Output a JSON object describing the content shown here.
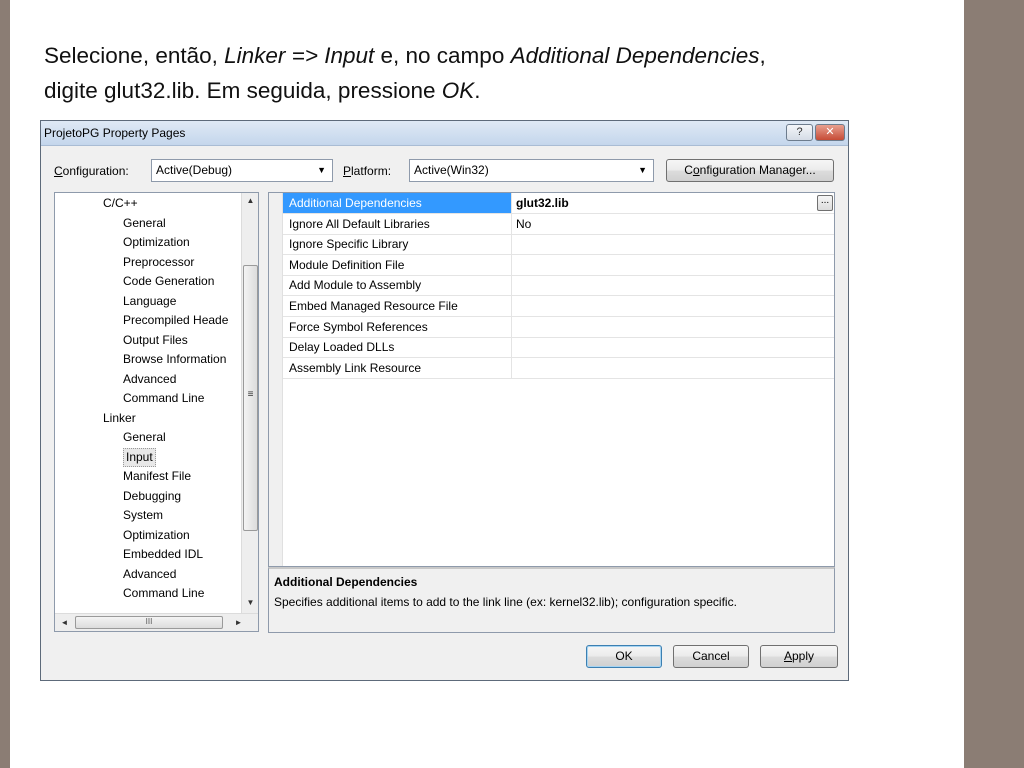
{
  "slide": {
    "line1_a": "Selecione, então, ",
    "line1_b": "Linker => Input",
    "line1_c": " e, no campo ",
    "line1_d": "Additional Dependencies",
    "line1_e": ",",
    "line2_a": "digite glut32.lib. Em seguida, pressione ",
    "line2_b": "OK",
    "line2_c": "."
  },
  "dialog": {
    "title": "ProjetoPG Property Pages",
    "help_label": "?",
    "close_label": "✕",
    "configuration_label_first": "C",
    "configuration_label_rest": "onfiguration:",
    "configuration_value": "Active(Debug)",
    "platform_label_first": "P",
    "platform_label_rest": "latform:",
    "platform_value": "Active(Win32)",
    "config_manager_a": "C",
    "config_manager_b": "o",
    "config_manager_c": "nfiguration Manager...",
    "dropdown_arrow": "▼",
    "ok_label": "OK",
    "cancel_label": "Cancel",
    "apply_label_first": "A",
    "apply_label_rest": "pply"
  },
  "tree": {
    "items": [
      {
        "label": "C/C++",
        "level": 1
      },
      {
        "label": "General",
        "level": 2
      },
      {
        "label": "Optimization",
        "level": 2
      },
      {
        "label": "Preprocessor",
        "level": 2
      },
      {
        "label": "Code Generation",
        "level": 2
      },
      {
        "label": "Language",
        "level": 2
      },
      {
        "label": "Precompiled Heade",
        "level": 2
      },
      {
        "label": "Output Files",
        "level": 2
      },
      {
        "label": "Browse Information",
        "level": 2
      },
      {
        "label": "Advanced",
        "level": 2
      },
      {
        "label": "Command Line",
        "level": 2
      },
      {
        "label": "Linker",
        "level": 1
      },
      {
        "label": "General",
        "level": 2
      },
      {
        "label": "Input",
        "level": 2,
        "selected": true
      },
      {
        "label": "Manifest File",
        "level": 2
      },
      {
        "label": "Debugging",
        "level": 2
      },
      {
        "label": "System",
        "level": 2
      },
      {
        "label": "Optimization",
        "level": 2
      },
      {
        "label": "Embedded IDL",
        "level": 2
      },
      {
        "label": "Advanced",
        "level": 2
      },
      {
        "label": "Command Line",
        "level": 2
      }
    ],
    "scroll_up": "▲",
    "scroll_down": "▼",
    "scroll_left": "◄",
    "scroll_right": "►",
    "grip": "≡",
    "hgrip": "III"
  },
  "grid": {
    "rows": [
      {
        "name": "Additional Dependencies",
        "value": "glut32.lib",
        "selected": true
      },
      {
        "name": "Ignore All Default Libraries",
        "value": "No"
      },
      {
        "name": "Ignore Specific Library",
        "value": ""
      },
      {
        "name": "Module Definition File",
        "value": ""
      },
      {
        "name": "Add Module to Assembly",
        "value": ""
      },
      {
        "name": "Embed Managed Resource File",
        "value": ""
      },
      {
        "name": "Force Symbol References",
        "value": ""
      },
      {
        "name": "Delay Loaded DLLs",
        "value": ""
      },
      {
        "name": "Assembly Link Resource",
        "value": ""
      }
    ],
    "ellipsis_label": "..."
  },
  "description": {
    "title": "Additional Dependencies",
    "body": "Specifies additional items to add to the link line (ex: kernel32.lib); configuration specific."
  },
  "colors": {
    "selection": "#3399ff",
    "frame": "#8b7d74"
  }
}
